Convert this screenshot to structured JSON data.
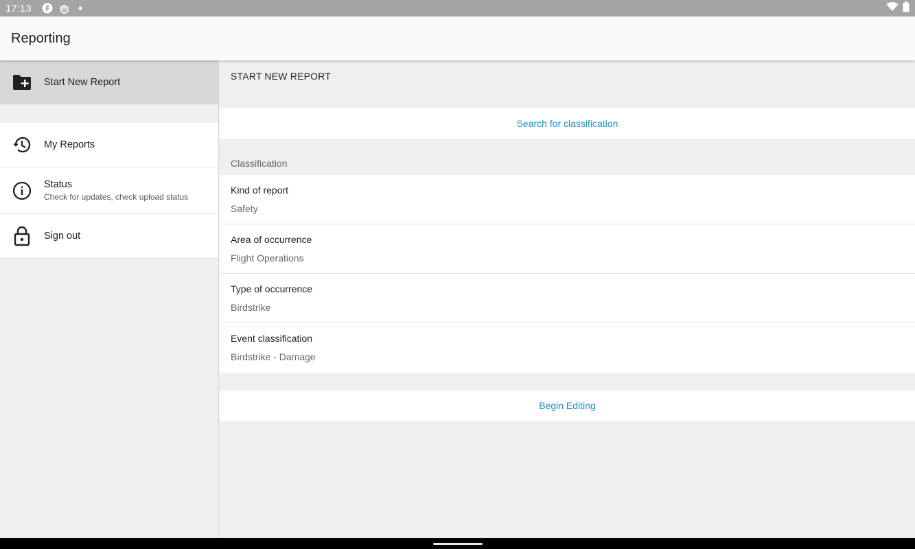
{
  "status_bar": {
    "time": "17:13",
    "icons": [
      "app-notification-icon",
      "settings-icon",
      "dot-icon"
    ],
    "right_icons": [
      "wifi-icon",
      "battery-icon"
    ]
  },
  "app_bar": {
    "title": "Reporting"
  },
  "sidebar": {
    "items": [
      {
        "label": "Start New Report",
        "icon": "folder-add-icon",
        "active": true
      },
      {
        "label": "My Reports",
        "icon": "history-icon"
      },
      {
        "label": "Status",
        "sublabel": "Check for updates, check upload status",
        "icon": "info-icon"
      },
      {
        "label": "Sign out",
        "icon": "lock-icon"
      }
    ]
  },
  "main": {
    "section_title": "START NEW REPORT",
    "search_action": "Search for classification",
    "classification_label": "Classification",
    "fields": [
      {
        "label": "Kind of report",
        "value": "Safety"
      },
      {
        "label": "Area of occurrence",
        "value": "Flight Operations"
      },
      {
        "label": "Type of occurrence",
        "value": "Birdstrike"
      },
      {
        "label": "Event classification",
        "value": "Birdstrike - Damage"
      }
    ],
    "begin_action": "Begin Editing"
  },
  "colors": {
    "accent": "#1e90c8",
    "app_bar": "#fafafa",
    "active_nav": "#d7d8d8",
    "status_bar": "#a4a4a4"
  }
}
